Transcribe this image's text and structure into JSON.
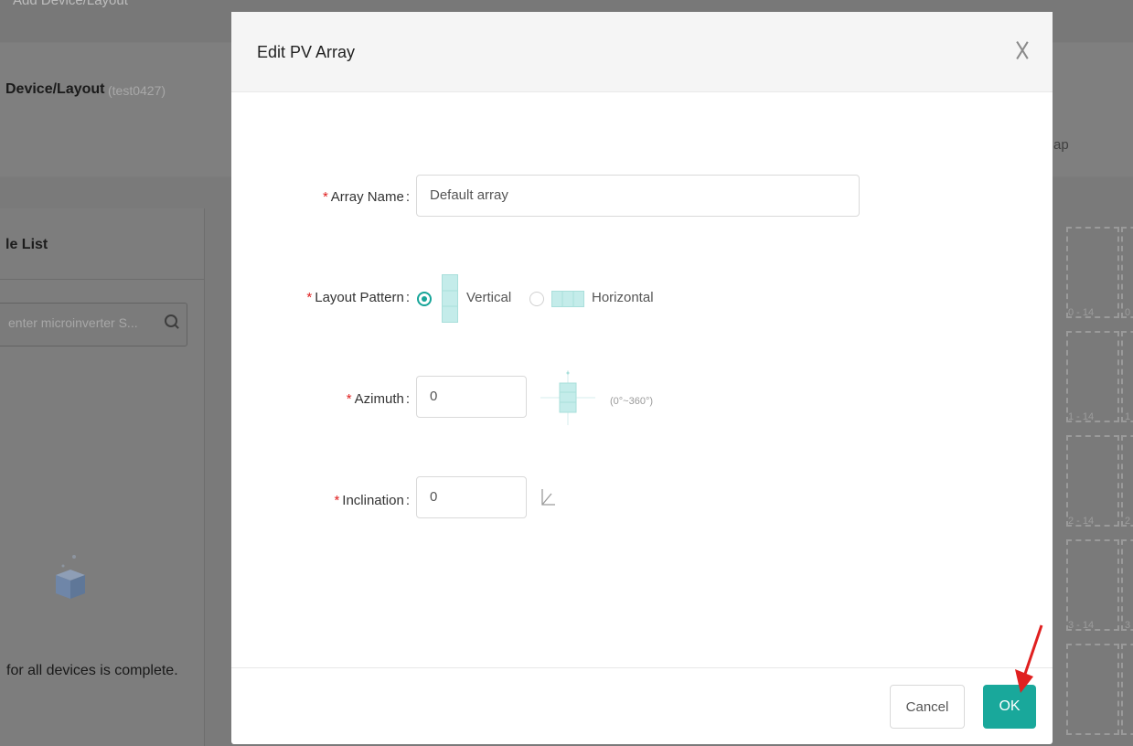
{
  "background": {
    "breadcrumb": "Add Device/Layout",
    "page_title": "Device/Layout",
    "page_subtitle": "(test0427)",
    "cut_text": "ap",
    "list_title": "le List",
    "search_placeholder": "enter microinverter S...",
    "empty_text": "for all devices is complete.",
    "grid_labels": [
      "0 - 14",
      "1 - 14",
      "2 - 14",
      "3 - 14"
    ],
    "grid_labels_right": [
      "0",
      "1",
      "2",
      "3"
    ]
  },
  "modal": {
    "title": "Edit PV Array",
    "close_icon": "close-icon",
    "required_mark": "*",
    "colon": ":",
    "array_name": {
      "label": "Array Name",
      "value": "Default array"
    },
    "layout_pattern": {
      "label": "Layout Pattern",
      "options": [
        {
          "label": "Vertical",
          "selected": true
        },
        {
          "label": "Horizontal",
          "selected": false
        }
      ]
    },
    "azimuth": {
      "label": "Azimuth",
      "value": "0",
      "range": "(0°~360°)",
      "icon": "compass-module-icon"
    },
    "inclination": {
      "label": "Inclination",
      "value": "0",
      "icon": "angle-icon"
    },
    "buttons": {
      "cancel": "Cancel",
      "ok": "OK"
    }
  },
  "colors": {
    "accent": "#19a89b",
    "required": "#e02020",
    "module_fill": "#c4ecea",
    "arrow": "#e02020"
  }
}
